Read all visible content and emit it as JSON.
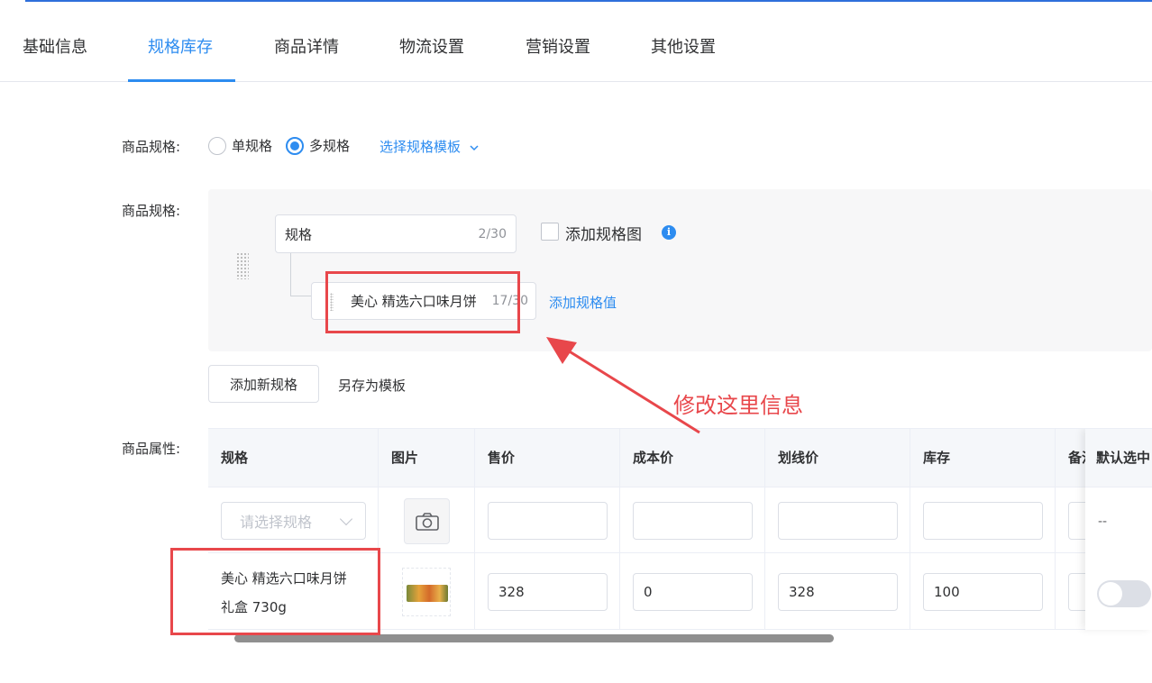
{
  "tabs": [
    "基础信息",
    "规格库存",
    "商品详情",
    "物流设置",
    "营销设置",
    "其他设置"
  ],
  "active_tab": "规格库存",
  "spec_type": {
    "label": "商品规格:",
    "single": "单规格",
    "multi": "多规格",
    "selected": "多规格",
    "template_link": "选择规格模板"
  },
  "spec_editor": {
    "label": "商品规格:",
    "name_value": "规格",
    "name_count": "2/30",
    "add_image_label": "添加规格图",
    "value_text": "美心 精选六口味月饼",
    "value_count": "17/30",
    "add_value_link": "添加规格值"
  },
  "actions": {
    "add_spec": "添加新规格",
    "save_template": "另存为模板"
  },
  "attributes": {
    "label": "商品属性:",
    "columns": [
      "规格",
      "图片",
      "售价",
      "成本价",
      "划线价",
      "库存",
      "备注",
      "默认选中"
    ],
    "batch_row": {
      "select_placeholder": "请选择规格",
      "default_placeholder": "--"
    },
    "rows": [
      {
        "spec_line1": "美心 精选六口味月饼",
        "spec_line2": "礼盒 730g",
        "price": "328",
        "cost": "0",
        "strike_price": "328",
        "stock": "100",
        "default_selected": false
      }
    ]
  },
  "annotation": {
    "text": "修改这里信息",
    "color": "#e8474b"
  },
  "colors": {
    "primary": "#2d8cf0",
    "annotation": "#e8474b"
  }
}
